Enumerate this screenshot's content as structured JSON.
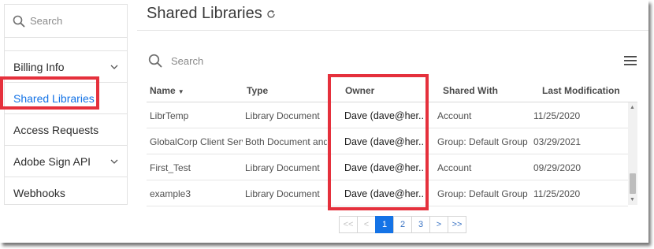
{
  "sidebar": {
    "search_placeholder": "Search",
    "items": [
      {
        "label": "Billing Info",
        "has_chevron": true
      },
      {
        "label": "Shared Libraries",
        "active": true
      },
      {
        "label": "Access Requests"
      },
      {
        "label": "Adobe Sign API",
        "has_chevron": true
      },
      {
        "label": "Webhooks"
      }
    ]
  },
  "main": {
    "title": "Shared Libraries",
    "search_placeholder": "Search",
    "columns": [
      "Name",
      "Type",
      "Owner",
      "Shared With",
      "Last Modification"
    ],
    "rows": [
      {
        "name": "LibrTemp",
        "type": "Library Document",
        "owner": "Dave (dave@her...",
        "shared_with": "Account",
        "last_mod": "11/25/2020"
      },
      {
        "name": "GlobalCorp Client Serv...",
        "type": "Both Document and F...",
        "owner": "Dave (dave@her...",
        "shared_with": "Group: Default Group",
        "last_mod": "03/29/2021"
      },
      {
        "name": "First_Test",
        "type": "Library Document",
        "owner": "Dave (dave@her...",
        "shared_with": "Account",
        "last_mod": "09/29/2020"
      },
      {
        "name": "example3",
        "type": "Library Document",
        "owner": "Dave (dave@her...",
        "shared_with": "Group: Default Group",
        "last_mod": "11/25/2020"
      }
    ]
  },
  "pagination": {
    "first": "<<",
    "prev": "<",
    "pages": [
      "1",
      "2",
      "3"
    ],
    "next": ">",
    "last": ">>",
    "current": "1"
  },
  "colors": {
    "accent": "#1473e6",
    "highlight": "#e5303c"
  }
}
